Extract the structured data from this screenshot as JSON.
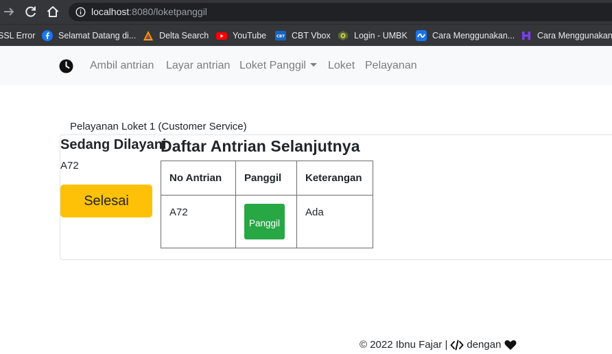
{
  "browser": {
    "url_host": "localhost",
    "url_rest": ":8080/loketpanggil",
    "back_icon": "arrow-right-icon",
    "reload_icon": "reload-icon",
    "home_icon": "home-icon"
  },
  "bookmarks": [
    {
      "label": "SSL Error",
      "icon": "none",
      "color": ""
    },
    {
      "label": "Selamat Datang di...",
      "icon": "facebook-icon",
      "color": "#1877f2"
    },
    {
      "label": "Delta Search",
      "icon": "delta-icon",
      "color": "#f4a300"
    },
    {
      "label": "YouTube",
      "icon": "youtube-icon",
      "color": "#ff0000"
    },
    {
      "label": "CBT Vbox",
      "icon": "cbt-icon",
      "color": "#1565c0"
    },
    {
      "label": "Login - UMBK",
      "icon": "umbk-icon",
      "color": "#6b8e23"
    },
    {
      "label": "Cara Menggunakan...",
      "icon": "wave-icon",
      "color": "#1a73e8"
    },
    {
      "label": "Cara Menggunakan...",
      "icon": "h-icon",
      "color": "#7e3ff2"
    }
  ],
  "navbar": {
    "brand_icon": "clock-icon",
    "items": [
      {
        "label": "Ambil antrian"
      },
      {
        "label": "Layar antrian"
      },
      {
        "label": "Loket Panggil"
      },
      {
        "label": "Loket"
      },
      {
        "label": "Pelayanan"
      }
    ]
  },
  "main": {
    "card_title": "Pelayanan Loket 1 (Customer Service)",
    "serving_heading": "Sedang Dilayani",
    "serving_number": "A72",
    "done_button": "Selesai",
    "queue_heading": "Daftar Antrian Selanjutnya",
    "table": {
      "headers": [
        "No Antrian",
        "Panggil",
        "Keterangan"
      ],
      "rows": [
        {
          "number": "A72",
          "call_button": "Panggil",
          "status": "Ada"
        }
      ]
    }
  },
  "footer": {
    "prefix": "© 2022 Ibnu Fajar |",
    "middle": "dengan",
    "code_icon": "code-icon",
    "heart_icon": "heart-icon"
  }
}
